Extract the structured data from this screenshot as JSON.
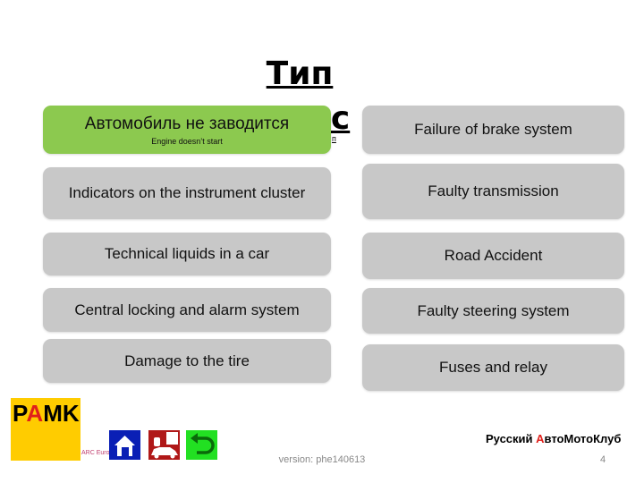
{
  "title": {
    "line1": "Тип",
    "line2_partial": "нс",
    "line3_partial": "п"
  },
  "left_buttons": [
    {
      "label": "Автомобиль не заводится",
      "sublabel": "Engine doesn’t start",
      "active": true
    },
    {
      "label": "Indicators on the instrument cluster"
    },
    {
      "label": "Technical liquids in a car"
    },
    {
      "label": "Central locking and alarm system"
    },
    {
      "label": "Damage to the tire"
    }
  ],
  "right_buttons": [
    {
      "label": "Failure of brake system"
    },
    {
      "label": "Faulty transmission"
    },
    {
      "label": "Road Accident"
    },
    {
      "label": "Faulty steering system"
    },
    {
      "label": "Fuses and relay"
    }
  ],
  "footer": {
    "logo": "PAMK",
    "arc_logo": "ARC Europe",
    "club_name_pre": "Русский ",
    "club_name_accent": "А",
    "club_name_post": "втоМотоКлуб",
    "version": "version: phe140613",
    "page_number": "4"
  },
  "nav_icons": [
    "home-icon",
    "help-operator-icon",
    "back-icon"
  ],
  "colors": {
    "active": "#8cc94f",
    "button": "#c8c8c8",
    "logo_bg": "#ffcc00",
    "accent_red": "#e0201b"
  }
}
